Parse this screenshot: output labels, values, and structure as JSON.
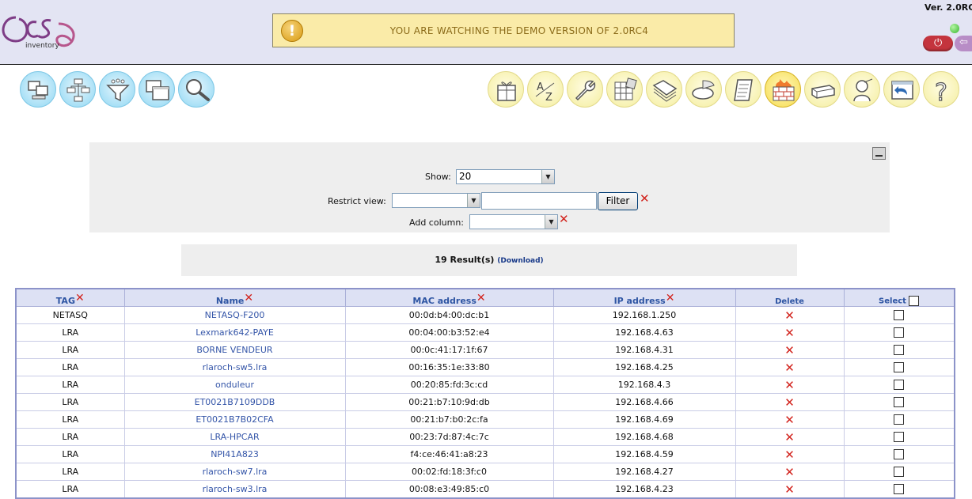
{
  "header": {
    "logo_text": "OCS",
    "logo_subtext": "inventory",
    "demo_banner": "YOU ARE WATCHING THE DEMO VERSION OF 2.0RC4",
    "version": "Ver. 2.0RC"
  },
  "menu": {
    "left_icons": [
      "computers-icon",
      "network-tree-icon",
      "filter-funnel-icon",
      "multi-windows-icon",
      "search-icon"
    ],
    "right_icons": [
      "package-gift-icon",
      "sort-az-icon",
      "wrench-icon",
      "registry-grid-icon",
      "documents-icon",
      "stats-pie-icon",
      "notes-icon",
      "firewall-icon",
      "network-card-icon",
      "user-help-icon",
      "back-window-icon",
      "help-question-icon"
    ],
    "active_icon": "firewall-icon"
  },
  "filters": {
    "show_label": "Show:",
    "show_value": "20",
    "restrict_label": "Restrict view:",
    "restrict_field_value": "",
    "restrict_text_value": "",
    "filter_button": "Filter",
    "add_column_label": "Add column:",
    "add_column_value": ""
  },
  "results": {
    "count_text": "19 Result(s)",
    "download_link": "(Download)"
  },
  "table": {
    "columns": [
      "TAG",
      "Name",
      "MAC address",
      "IP address",
      "Delete",
      "Select"
    ],
    "rows": [
      {
        "tag": "NETASQ",
        "name": "NETASQ-F200",
        "mac": "00:0d:b4:00:dc:b1",
        "ip": "192.168.1.250"
      },
      {
        "tag": "LRA",
        "name": "Lexmark642-PAYE",
        "mac": "00:04:00:b3:52:e4",
        "ip": "192.168.4.63"
      },
      {
        "tag": "LRA",
        "name": "BORNE VENDEUR",
        "mac": "00:0c:41:17:1f:67",
        "ip": "192.168.4.31"
      },
      {
        "tag": "LRA",
        "name": "rlaroch-sw5.lra",
        "mac": "00:16:35:1e:33:80",
        "ip": "192.168.4.25"
      },
      {
        "tag": "LRA",
        "name": "onduleur",
        "mac": "00:20:85:fd:3c:cd",
        "ip": "192.168.4.3"
      },
      {
        "tag": "LRA",
        "name": "ET0021B7109DDB",
        "mac": "00:21:b7:10:9d:db",
        "ip": "192.168.4.66"
      },
      {
        "tag": "LRA",
        "name": "ET0021B7B02CFA",
        "mac": "00:21:b7:b0:2c:fa",
        "ip": "192.168.4.69"
      },
      {
        "tag": "LRA",
        "name": "LRA-HPCAR",
        "mac": "00:23:7d:87:4c:7c",
        "ip": "192.168.4.68"
      },
      {
        "tag": "LRA",
        "name": "NPI41A823",
        "mac": "f4:ce:46:41:a8:23",
        "ip": "192.168.4.59"
      },
      {
        "tag": "LRA",
        "name": "rlaroch-sw7.lra",
        "mac": "00:02:fd:18:3f:c0",
        "ip": "192.168.4.27"
      },
      {
        "tag": "LRA",
        "name": "rlaroch-sw3.lra",
        "mac": "00:08:e3:49:85:c0",
        "ip": "192.168.4.23"
      }
    ]
  }
}
